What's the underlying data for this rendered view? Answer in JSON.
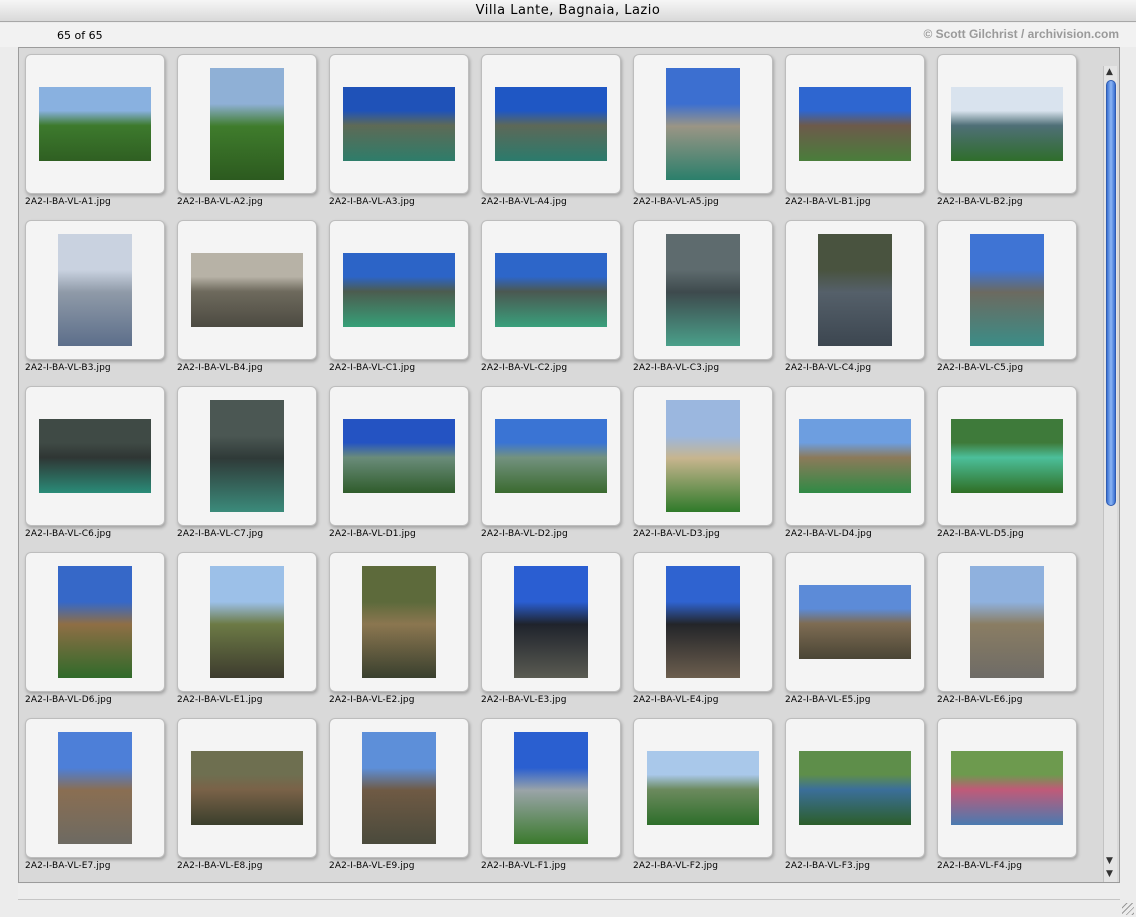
{
  "window": {
    "title": "Villa Lante, Bagnaia, Lazio"
  },
  "infobar": {
    "count": "65 of 65",
    "credit": "© Scott Gilchrist / archivision.com"
  },
  "colors": {
    "scroll_accent": "#3a6fd2",
    "tile_bg": "#f4f4f4"
  },
  "icons": {
    "scroll_up": "triangle-up-icon",
    "scroll_down": "triangle-down-icon",
    "resize": "resize-grip-icon"
  },
  "thumbnails": [
    {
      "file": "2A2-I-BA-VL-A1.jpg",
      "orientation": "landscape",
      "palette": [
        "#89b1e0",
        "#3d7a2d",
        "#2f5f22"
      ]
    },
    {
      "file": "2A2-I-BA-VL-A2.jpg",
      "orientation": "portrait",
      "palette": [
        "#8fb0d6",
        "#3f7c2c",
        "#2c5a1f"
      ]
    },
    {
      "file": "2A2-I-BA-VL-A3.jpg",
      "orientation": "landscape",
      "palette": [
        "#1f52b8",
        "#5e6a56",
        "#2e7d6a"
      ]
    },
    {
      "file": "2A2-I-BA-VL-A4.jpg",
      "orientation": "landscape",
      "palette": [
        "#1f57c4",
        "#5d6858",
        "#2b7b6c"
      ]
    },
    {
      "file": "2A2-I-BA-VL-A5.jpg",
      "orientation": "portrait",
      "palette": [
        "#3c6fd0",
        "#9a9585",
        "#2b7f6b"
      ]
    },
    {
      "file": "2A2-I-BA-VL-B1.jpg",
      "orientation": "landscape",
      "palette": [
        "#2e66d0",
        "#6d5a4b",
        "#4a7d3b"
      ]
    },
    {
      "file": "2A2-I-BA-VL-B2.jpg",
      "orientation": "landscape",
      "palette": [
        "#d9e3ee",
        "#4f6f77",
        "#2f6e2b"
      ]
    },
    {
      "file": "2A2-I-BA-VL-B3.jpg",
      "orientation": "portrait",
      "palette": [
        "#c9d2e0",
        "#8f9aa8",
        "#5c6e8a"
      ]
    },
    {
      "file": "2A2-I-BA-VL-B4.jpg",
      "orientation": "landscape",
      "palette": [
        "#b7b2a6",
        "#6e6a5d",
        "#4c4a41"
      ]
    },
    {
      "file": "2A2-I-BA-VL-C1.jpg",
      "orientation": "landscape",
      "palette": [
        "#2c64c7",
        "#4c5c4f",
        "#36a078"
      ]
    },
    {
      "file": "2A2-I-BA-VL-C2.jpg",
      "orientation": "landscape",
      "palette": [
        "#2d66c9",
        "#4b5851",
        "#39a07c"
      ]
    },
    {
      "file": "2A2-I-BA-VL-C3.jpg",
      "orientation": "portrait",
      "palette": [
        "#5e6b6e",
        "#3e4a4d",
        "#4aa08a"
      ]
    },
    {
      "file": "2A2-I-BA-VL-C4.jpg",
      "orientation": "portrait",
      "palette": [
        "#49533f",
        "#55606a",
        "#3c4650"
      ]
    },
    {
      "file": "2A2-I-BA-VL-C5.jpg",
      "orientation": "portrait",
      "palette": [
        "#3f74d4",
        "#6c6a60",
        "#3b8d87"
      ]
    },
    {
      "file": "2A2-I-BA-VL-C6.jpg",
      "orientation": "landscape",
      "palette": [
        "#3f4a45",
        "#2f3634",
        "#2a8c78"
      ]
    },
    {
      "file": "2A2-I-BA-VL-C7.jpg",
      "orientation": "portrait",
      "palette": [
        "#4b5753",
        "#2f3a38",
        "#3b8b7b"
      ]
    },
    {
      "file": "2A2-I-BA-VL-D1.jpg",
      "orientation": "landscape",
      "palette": [
        "#2453c2",
        "#6a8c7a",
        "#2f5c2b"
      ]
    },
    {
      "file": "2A2-I-BA-VL-D2.jpg",
      "orientation": "landscape",
      "palette": [
        "#3a74d4",
        "#73927f",
        "#3a6a2f"
      ]
    },
    {
      "file": "2A2-I-BA-VL-D3.jpg",
      "orientation": "portrait",
      "palette": [
        "#9bb7df",
        "#c7b58e",
        "#2f7a2a"
      ]
    },
    {
      "file": "2A2-I-BA-VL-D4.jpg",
      "orientation": "landscape",
      "palette": [
        "#6d9ee0",
        "#8c7a5a",
        "#2f8a45"
      ]
    },
    {
      "file": "2A2-I-BA-VL-D5.jpg",
      "orientation": "landscape",
      "palette": [
        "#3e7a3a",
        "#4cbf9a",
        "#2f6e24"
      ]
    },
    {
      "file": "2A2-I-BA-VL-D6.jpg",
      "orientation": "portrait",
      "palette": [
        "#3668c8",
        "#8f6e45",
        "#2f6a2a"
      ]
    },
    {
      "file": "2A2-I-BA-VL-E1.jpg",
      "orientation": "portrait",
      "palette": [
        "#9cc0e8",
        "#6c7a45",
        "#3d3b2e"
      ]
    },
    {
      "file": "2A2-I-BA-VL-E2.jpg",
      "orientation": "portrait",
      "palette": [
        "#5d6a3b",
        "#8b7650",
        "#39402e"
      ]
    },
    {
      "file": "2A2-I-BA-VL-E3.jpg",
      "orientation": "portrait",
      "palette": [
        "#2a5ed2",
        "#1f232c",
        "#5a5b52"
      ]
    },
    {
      "file": "2A2-I-BA-VL-E4.jpg",
      "orientation": "portrait",
      "palette": [
        "#2f63d0",
        "#232529",
        "#6c5e4e"
      ]
    },
    {
      "file": "2A2-I-BA-VL-E5.jpg",
      "orientation": "landscape",
      "palette": [
        "#5c8bd8",
        "#7e6c53",
        "#4a4535"
      ]
    },
    {
      "file": "2A2-I-BA-VL-E6.jpg",
      "orientation": "portrait",
      "palette": [
        "#8fb1de",
        "#8a7d63",
        "#6e6b66"
      ]
    },
    {
      "file": "2A2-I-BA-VL-E7.jpg",
      "orientation": "portrait",
      "palette": [
        "#4d7fd8",
        "#8a6e52",
        "#6d6a62"
      ]
    },
    {
      "file": "2A2-I-BA-VL-E8.jpg",
      "orientation": "landscape",
      "palette": [
        "#6e6f50",
        "#7a6248",
        "#3a3f2c"
      ]
    },
    {
      "file": "2A2-I-BA-VL-E9.jpg",
      "orientation": "portrait",
      "palette": [
        "#5d8fd9",
        "#6f5a44",
        "#4a4a3c"
      ]
    },
    {
      "file": "2A2-I-BA-VL-F1.jpg",
      "orientation": "portrait",
      "palette": [
        "#2a5fd0",
        "#9aa4a8",
        "#3a7a2c"
      ]
    },
    {
      "file": "2A2-I-BA-VL-F2.jpg",
      "orientation": "landscape",
      "palette": [
        "#a9c8ea",
        "#6c8a5e",
        "#2d6e2a"
      ]
    },
    {
      "file": "2A2-I-BA-VL-F3.jpg",
      "orientation": "landscape",
      "palette": [
        "#5e8e4a",
        "#3b6f9a",
        "#2c5e2a"
      ]
    },
    {
      "file": "2A2-I-BA-VL-F4.jpg",
      "orientation": "landscape",
      "palette": [
        "#6d9a4e",
        "#c05a78",
        "#4a7ab0"
      ]
    }
  ]
}
